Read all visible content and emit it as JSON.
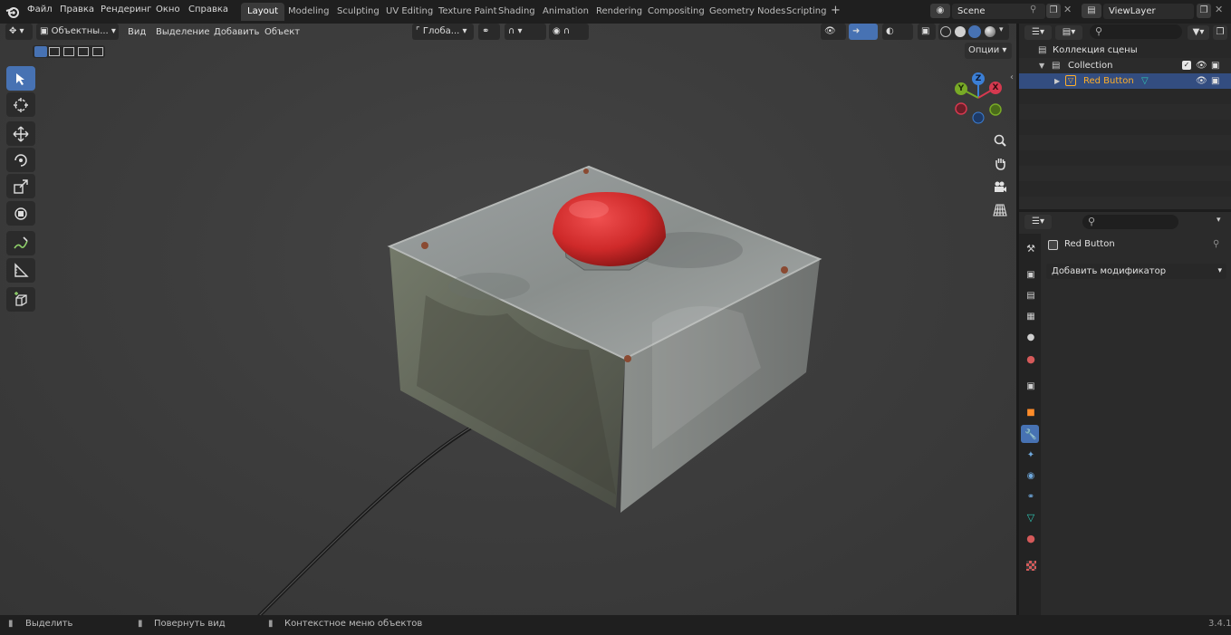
{
  "menu": [
    "Файл",
    "Правка",
    "Рендеринг",
    "Окно",
    "Справка"
  ],
  "workspaces": [
    {
      "label": "Layout",
      "active": true
    },
    {
      "label": "Modeling",
      "active": false
    },
    {
      "label": "Sculpting",
      "active": false
    },
    {
      "label": "UV Editing",
      "active": false
    },
    {
      "label": "Texture Paint",
      "active": false
    },
    {
      "label": "Shading",
      "active": false
    },
    {
      "label": "Animation",
      "active": false
    },
    {
      "label": "Rendering",
      "active": false
    },
    {
      "label": "Compositing",
      "active": false
    },
    {
      "label": "Geometry Nodes",
      "active": false
    },
    {
      "label": "Scripting",
      "active": false
    }
  ],
  "add_workspace": "+",
  "scene_name": "Scene",
  "view_layer": "ViewLayer",
  "viewport_header": {
    "mode": "Объектны...",
    "view": "Вид",
    "select": "Выделение",
    "add": "Добавить",
    "object": "Объект",
    "orientation": "Глоба...",
    "options": "Опции"
  },
  "gizmo": {
    "x": "X",
    "y": "Y",
    "z": "Z"
  },
  "outliner": {
    "scene_collection": "Коллекция сцены",
    "collection": "Collection",
    "object": "Red Button"
  },
  "properties": {
    "object_name": "Red Button",
    "add_modifier": "Добавить модификатор"
  },
  "statusbar": {
    "select": "Выделить",
    "rotate_view": "Повернуть вид",
    "context_menu": "Контекстное меню объектов",
    "version": "3.4.1"
  },
  "colors": {
    "accent": "#4772b3",
    "selected_row": "#334d80",
    "object_highlight": "#ffaf29",
    "axis_x": "#d5394f",
    "axis_y": "#78aa26",
    "axis_z": "#3b7fd6",
    "button_red": "#cf2a2a"
  }
}
